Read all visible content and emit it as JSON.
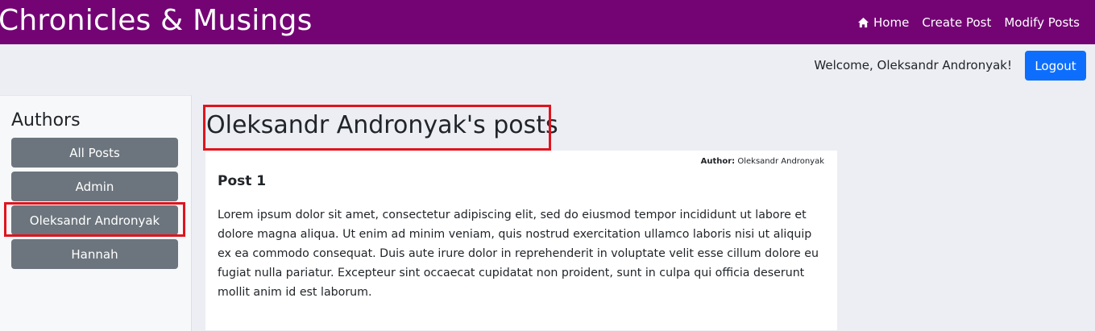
{
  "navbar": {
    "brand": "Chronicles & Musings",
    "links": [
      {
        "label": "Home",
        "icon": "home-icon"
      },
      {
        "label": "Create Post"
      },
      {
        "label": "Modify Posts"
      }
    ]
  },
  "user_bar": {
    "welcome": "Welcome, Oleksandr Andronyak!",
    "logout_label": "Logout"
  },
  "sidebar": {
    "title": "Authors",
    "items": [
      {
        "label": "All Posts"
      },
      {
        "label": "Admin"
      },
      {
        "label": "Oleksandr Andronyak"
      },
      {
        "label": "Hannah"
      }
    ]
  },
  "main": {
    "title": "Oleksandr Andronyak's posts",
    "posts": [
      {
        "author_label": "Author:",
        "author": "Oleksandr Andronyak",
        "title": "Post 1",
        "body": "Lorem ipsum dolor sit amet, consectetur adipiscing elit, sed do eiusmod tempor incididunt ut labore et dolore magna aliqua. Ut enim ad minim veniam, quis nostrud exercitation ullamco laboris nisi ut aliquip ex ea commodo consequat. Duis aute irure dolor in reprehenderit in voluptate velit esse cillum dolore eu fugiat nulla pariatur. Excepteur sint occaecat cupidatat non proident, sunt in culpa qui officia deserunt mollit anim id est laborum."
      }
    ]
  },
  "colors": {
    "navbar_bg": "#740474",
    "primary_button": "#0d6efd",
    "secondary_button": "#6c757d",
    "highlight": "#e0141e"
  }
}
